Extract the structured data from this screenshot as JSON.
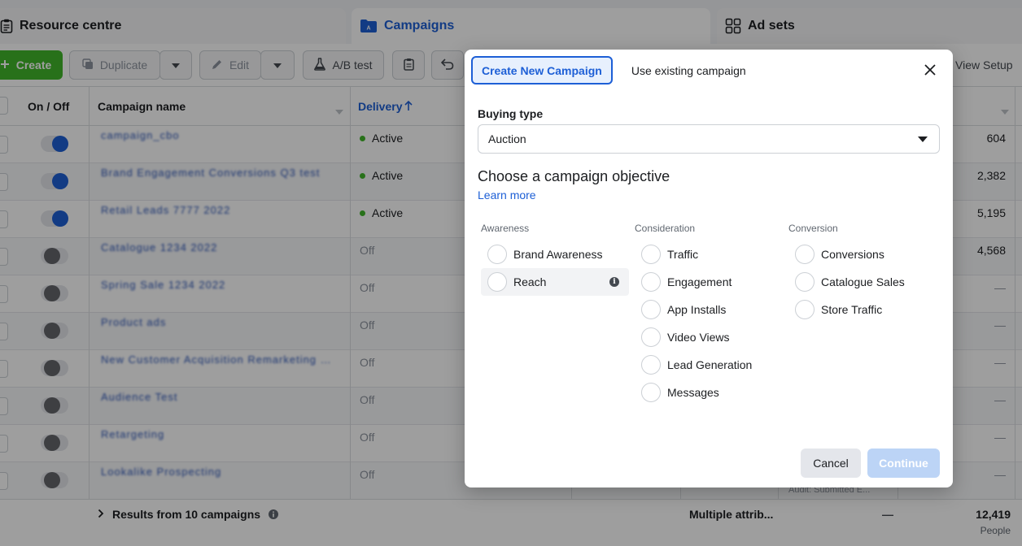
{
  "tabs": {
    "resource": "Resource centre",
    "campaigns": "Campaigns",
    "adsets": "Ad sets"
  },
  "toolbar": {
    "create": "Create",
    "duplicate": "Duplicate",
    "edit": "Edit",
    "ab_test": "A/B test",
    "view_setup": "View Setup"
  },
  "table": {
    "headers": {
      "on_off": "On / Off",
      "campaign_name": "Campaign name",
      "delivery": "Delivery"
    },
    "rows": [
      {
        "name": "campaign_cbo",
        "status": "Active",
        "on": true,
        "value": "604"
      },
      {
        "name": "Brand Engagement Conversions Q3 test",
        "status": "Active",
        "on": true,
        "value": "2,382"
      },
      {
        "name": "Retail Leads 7777 2022",
        "status": "Active",
        "on": true,
        "value": "5,195"
      },
      {
        "name": "Catalogue 1234 2022",
        "status": "Off",
        "on": false,
        "value": "4,568"
      },
      {
        "name": "Spring Sale 1234 2022",
        "status": "Off",
        "on": false,
        "value": "—"
      },
      {
        "name": "Product ads",
        "status": "Off",
        "on": false,
        "value": "—"
      },
      {
        "name": "New Customer Acquisition Remarketing Prospecting ...",
        "status": "Off",
        "on": false,
        "value": "—"
      },
      {
        "name": "Audience Test",
        "status": "Off",
        "on": false,
        "value": "—"
      },
      {
        "name": "Retargeting",
        "status": "Off",
        "on": false,
        "value": "—"
      },
      {
        "name": "Lookalike Prospecting",
        "status": "Off",
        "on": false,
        "value": "—"
      }
    ],
    "footer": {
      "results": "Results from 10 campaigns",
      "attribution": "Multiple attrib...",
      "dash": "—",
      "total": "12,419",
      "total_unit": "People"
    },
    "audit": "Audit: Submitted E..."
  },
  "modal": {
    "tab_new": "Create New Campaign",
    "tab_existing": "Use existing campaign",
    "buying_type_label": "Buying type",
    "buying_type_value": "Auction",
    "objective_title": "Choose a campaign objective",
    "learn_more": "Learn more",
    "columns": [
      {
        "header": "Awareness",
        "options": [
          "Brand Awareness",
          "Reach"
        ]
      },
      {
        "header": "Consideration",
        "options": [
          "Traffic",
          "Engagement",
          "App Installs",
          "Video Views",
          "Lead Generation",
          "Messages"
        ]
      },
      {
        "header": "Conversion",
        "options": [
          "Conversions",
          "Catalogue Sales",
          "Store Traffic"
        ]
      }
    ],
    "cancel": "Cancel",
    "continue": "Continue"
  },
  "colors": {
    "accent": "#1d5fd6",
    "create_green": "#42b72a",
    "continue_disabled": "#bcd4f6"
  }
}
